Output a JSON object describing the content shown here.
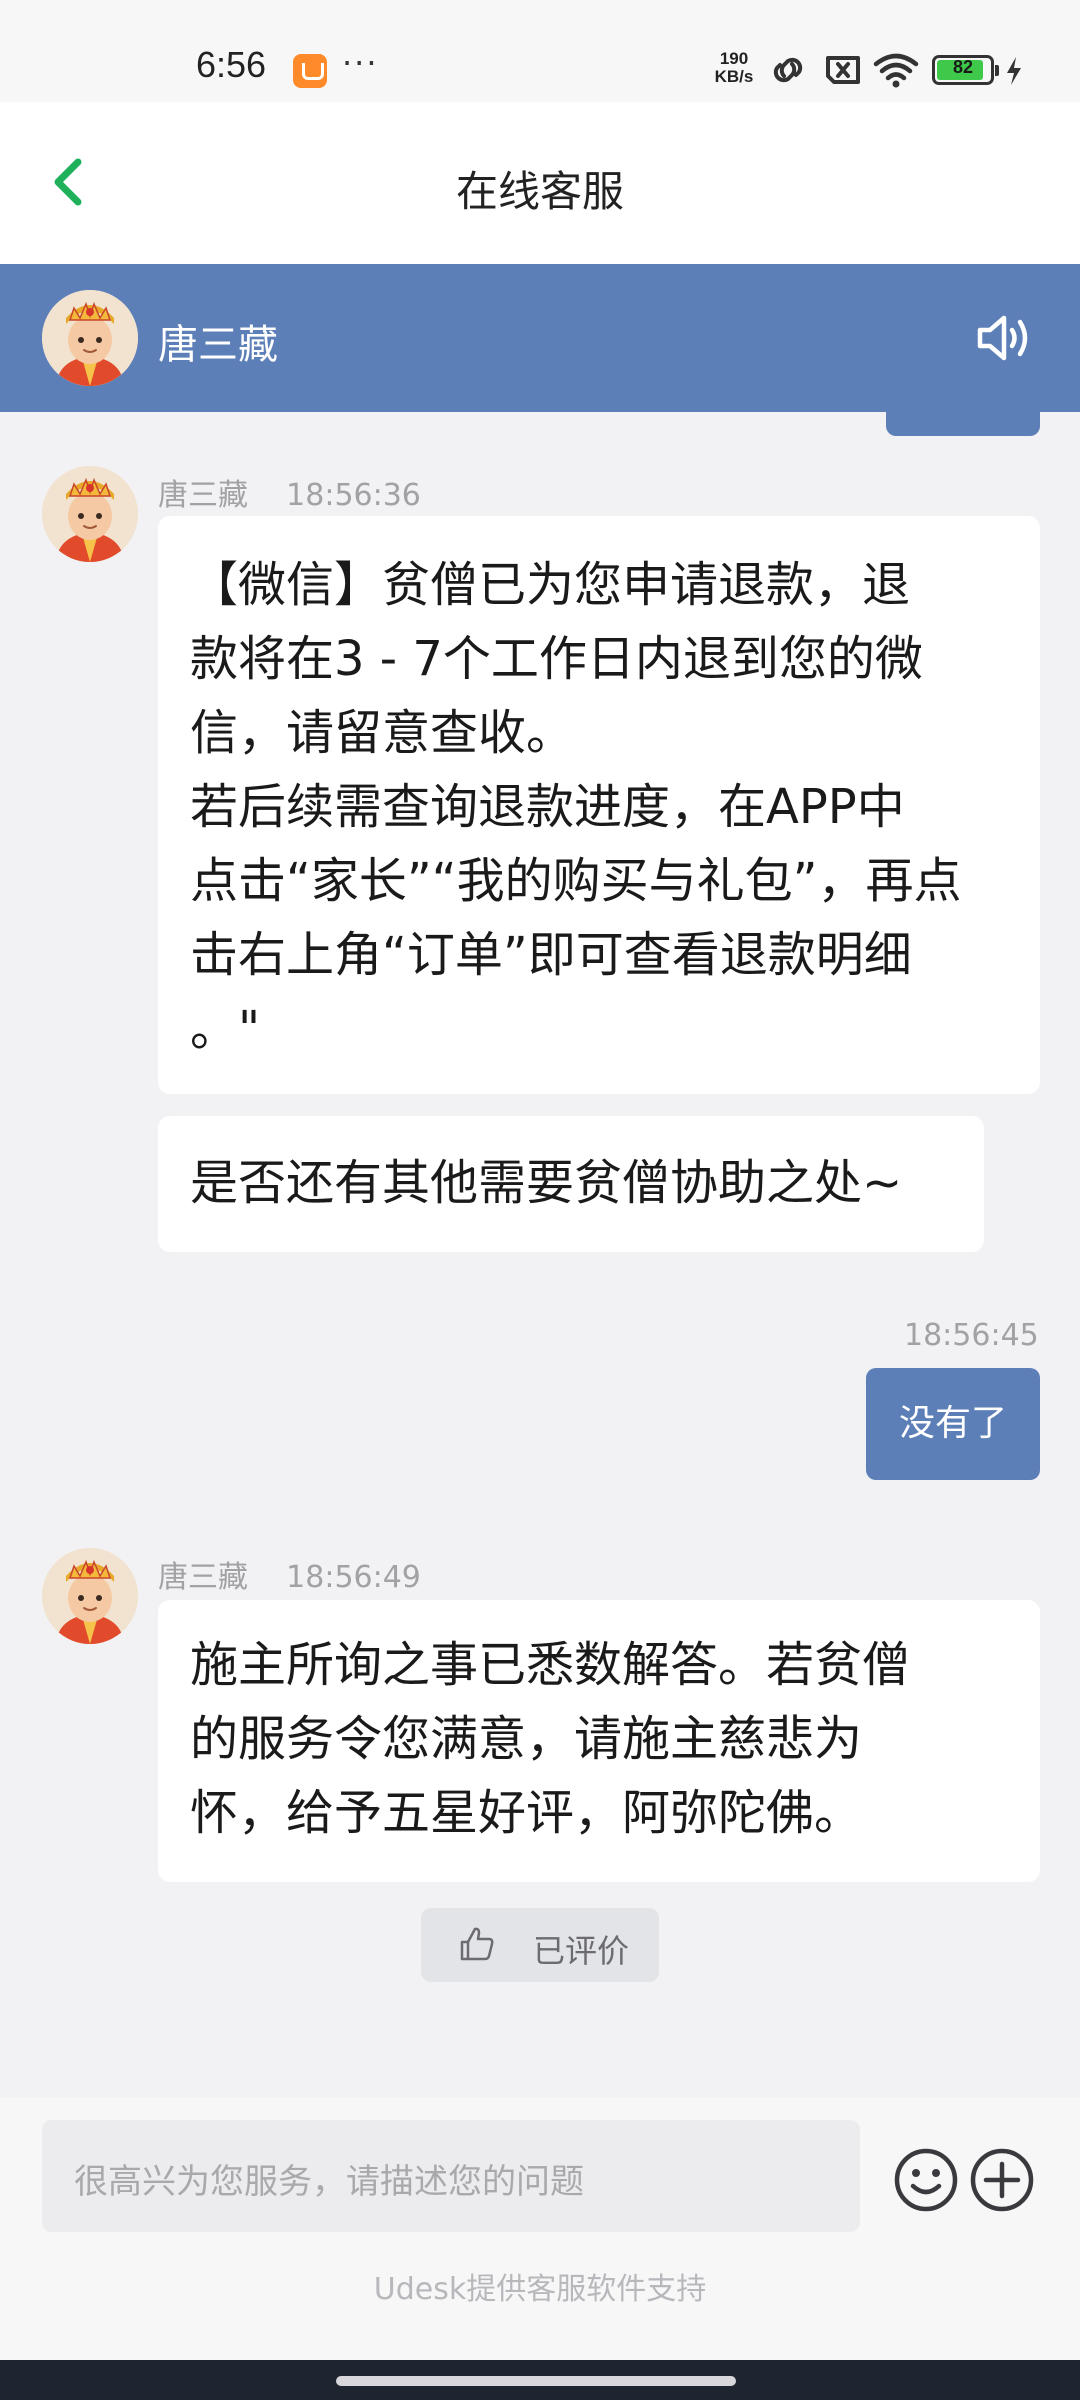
{
  "status_bar": {
    "time": "6:56",
    "dots": "···",
    "speed_value": "190",
    "speed_unit": "KB/s",
    "battery": "82",
    "battery_level": 0.82
  },
  "header": {
    "title": "在线客服"
  },
  "agent": {
    "name": "唐三藏"
  },
  "messages": [
    {
      "sender": "唐三藏",
      "time": "18:56:36",
      "bubbles": [
        {
          "lines": [
            "【微信】贫僧已为您申请退款，退",
            "款将在3 - 7个工作日内退到您的微",
            "信，请留意查收。",
            "若后续需查询退款进度，在APP中",
            "点击“家长”“我的购买与礼包”，再点",
            "击右上角“订单”即可查看退款明细",
            "。\""
          ]
        },
        {
          "lines": [
            "是否还有其他需要贫僧协助之处~"
          ]
        }
      ]
    },
    {
      "time": "18:56:45",
      "text": "没有了"
    },
    {
      "sender": "唐三藏",
      "time": "18:56:49",
      "bubbles": [
        {
          "lines": [
            "施主所询之事已悉数解答。若贫僧",
            "的服务令您满意，请施主慈悲为",
            "怀，给予五星好评，阿弥陀佛。"
          ]
        }
      ]
    }
  ],
  "rating": {
    "label": "已评价"
  },
  "input": {
    "placeholder": "很高兴为您服务，请描述您的问题"
  },
  "footer": {
    "powered_by": "Udesk提供客服软件支持"
  },
  "colors": {
    "accent": "#5d7fb8",
    "back_arrow": "#1fb05a",
    "battery": "#3ec94a"
  }
}
